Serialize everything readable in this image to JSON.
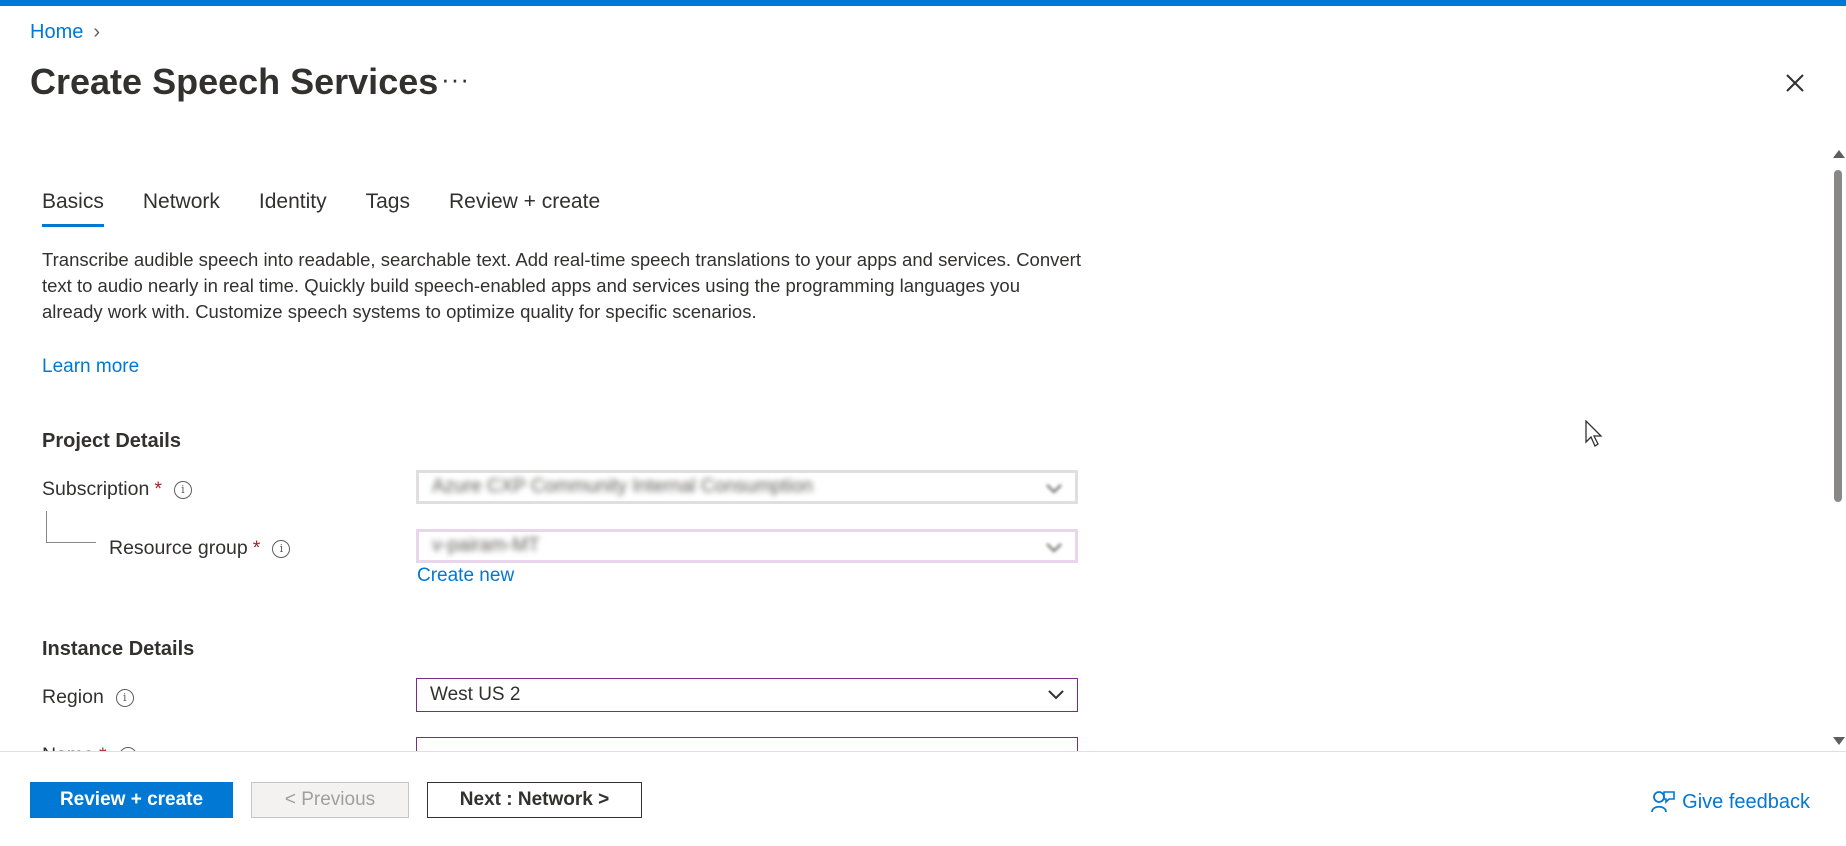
{
  "breadcrumb": {
    "home": "Home",
    "separator": "›"
  },
  "page": {
    "title": "Create Speech Services",
    "more": "···"
  },
  "tabs": [
    {
      "label": "Basics",
      "active": true
    },
    {
      "label": "Network",
      "active": false
    },
    {
      "label": "Identity",
      "active": false
    },
    {
      "label": "Tags",
      "active": false
    },
    {
      "label": "Review + create",
      "active": false
    }
  ],
  "description": "Transcribe audible speech into readable, searchable text. Add real-time speech translations to your apps and services. Convert text to audio nearly in real time. Quickly build speech-enabled apps and services using the programming languages you already work with. Customize speech systems to optimize quality for specific scenarios.",
  "learn_more": "Learn more",
  "project_details": {
    "heading": "Project Details",
    "subscription": {
      "label": "Subscription",
      "required": "*",
      "value": "Azure CXP Community Internal Consumption"
    },
    "resource_group": {
      "label": "Resource group",
      "required": "*",
      "value": "v-pairam-MT",
      "create_new": "Create new"
    }
  },
  "instance_details": {
    "heading": "Instance Details",
    "region": {
      "label": "Region",
      "value": "West US 2"
    },
    "name": {
      "label": "Name",
      "required": "*",
      "value": ""
    }
  },
  "footer": {
    "review_create": "Review + create",
    "previous": "< Previous",
    "next": "Next : Network >",
    "feedback": "Give feedback"
  },
  "colors": {
    "accent": "#0078d4",
    "required": "#a4262c",
    "focus_border": "#7b2a8a"
  }
}
